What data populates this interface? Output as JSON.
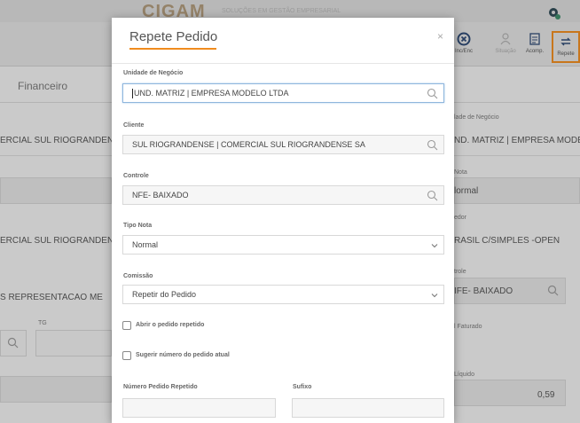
{
  "background": {
    "logo_text": "CIGAM",
    "logo_subtitle": "SOLUÇÕES EM GESTÃO EMPRESARIAL",
    "toolbar": [
      {
        "label": "Inc/Enc",
        "icon": "x-circle-icon"
      },
      {
        "label": "Situação",
        "icon": "person-icon"
      },
      {
        "label": "Acomp.",
        "icon": "calendar-icon"
      },
      {
        "label": "Repete",
        "icon": "repeat-icon"
      }
    ],
    "tab_financeiro": "Financeiro",
    "left_values": {
      "cliente": "ERCIAL SUL RIOGRANDENSE S",
      "cliente2": "ERCIAL SUL RIOGRANDENSE S",
      "representante": "S REPRESENTACAO ME",
      "tg_label": "TG"
    },
    "right_labels": {
      "unidade": "lade de Negócio",
      "nota": "Nota",
      "vendedor": "edor",
      "controle": "trole",
      "faturado": "l Faturado",
      "liquido": "Líquido"
    },
    "right_values": {
      "unidade": "ND. MATRIZ | EMPRESA MODELO L",
      "nota": "lormal",
      "vendedor": "RASIL C/SIMPLES -OPEN",
      "controle": "IFE- BAIXADO",
      "liquido": "0,59"
    },
    "colors": {
      "accent": "#f08c1e"
    }
  },
  "modal": {
    "title": "Repete Pedido",
    "close_glyph": "×",
    "fields": {
      "unidade": {
        "label": "Unidade de Negócio",
        "value": "UND. MATRIZ | EMPRESA MODELO LTDA"
      },
      "cliente": {
        "label": "Cliente",
        "value": "SUL RIOGRANDENSE | COMERCIAL SUL RIOGRANDENSE SA"
      },
      "controle": {
        "label": "Controle",
        "value": "NFE- BAIXADO"
      },
      "tipo_nota": {
        "label": "Tipo Nota",
        "value": "Normal"
      },
      "comissao": {
        "label": "Comissão",
        "value": "Repetir do Pedido"
      }
    },
    "checkboxes": {
      "abrir": {
        "label": "Abrir o pedido repetido",
        "checked": false
      },
      "sugerir": {
        "label": "Sugerir número do pedido atual",
        "checked": false
      }
    },
    "numero_pedido_label": "Número Pedido Repetido",
    "sufixo_label": "Sufixo",
    "numero_pedido_value": "",
    "sufixo_value": ""
  }
}
